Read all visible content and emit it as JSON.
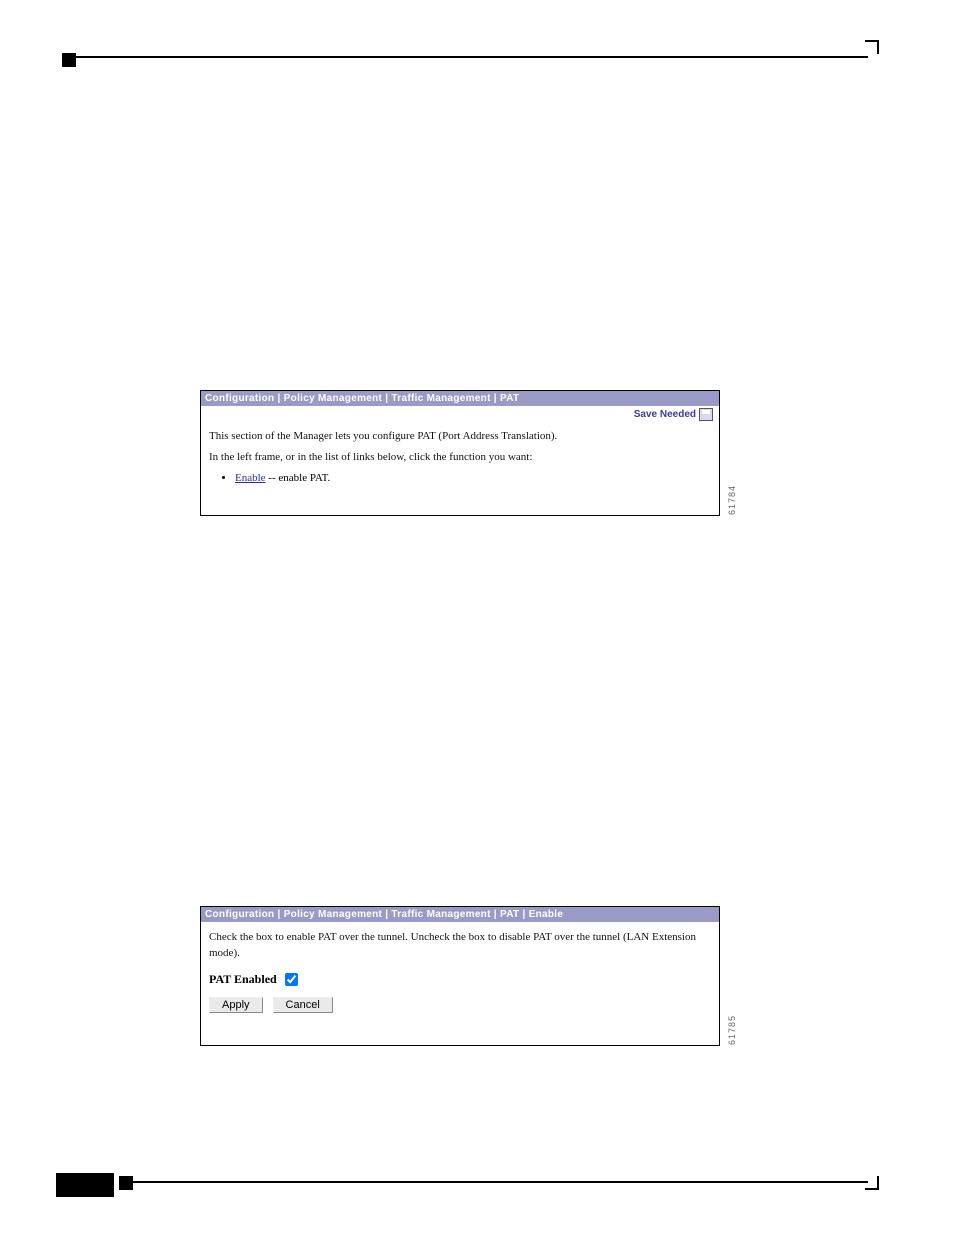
{
  "panel1": {
    "breadcrumb": "Configuration | Policy Management | Traffic Management | PAT",
    "save_label": "Save Needed",
    "line1": "This section of the Manager lets you configure PAT (Port Address Translation).",
    "line2": "In the left frame, or in the list of links below, click the function you want:",
    "link_text": "Enable",
    "link_suffix": " -- enable PAT.",
    "side": "61784"
  },
  "panel2": {
    "breadcrumb": "Configuration | Policy Management | Traffic Management | PAT | Enable",
    "line1": "Check the box to enable PAT over the tunnel. Uncheck the box to disable PAT over the tunnel (LAN Extension mode).",
    "checkbox_label": "PAT Enabled",
    "apply": "Apply",
    "cancel": "Cancel",
    "side": "61785"
  },
  "chart_data": {
    "type": "table",
    "title": "PAT Enable configuration",
    "rows": [
      {
        "field": "PAT Enabled",
        "value": true
      }
    ]
  }
}
